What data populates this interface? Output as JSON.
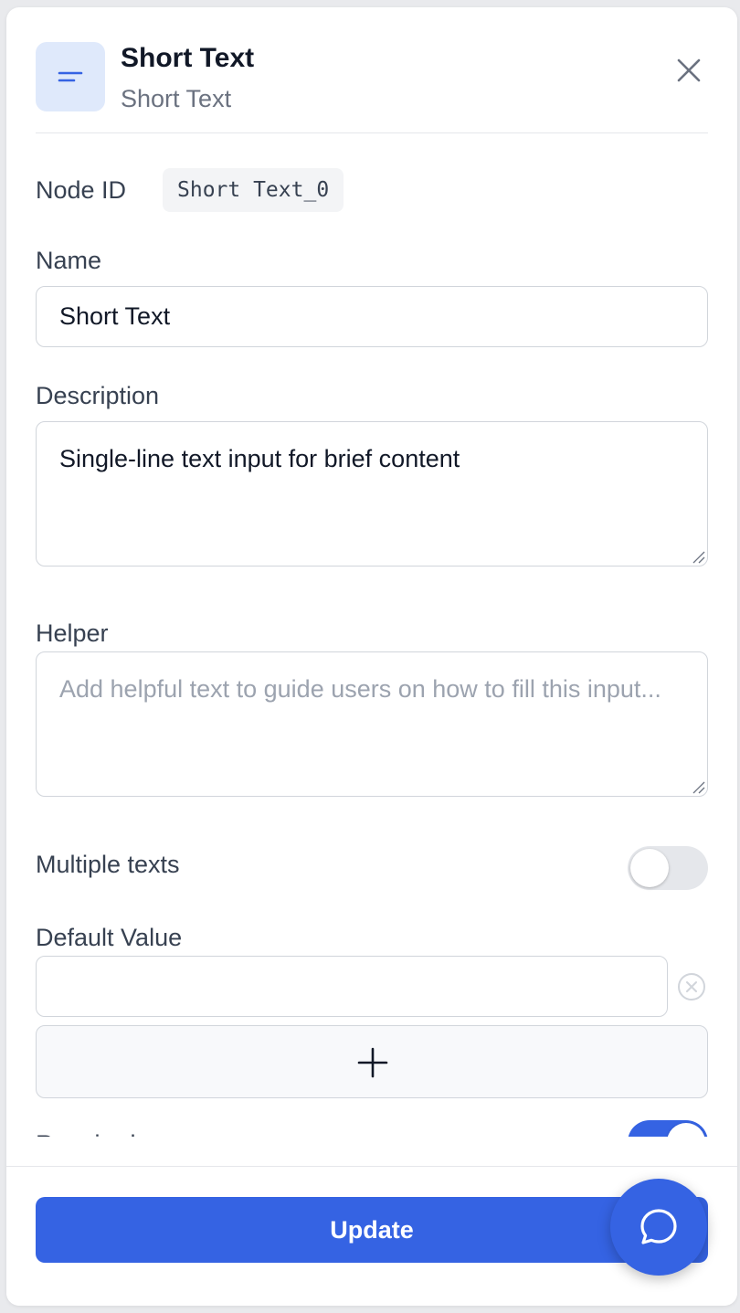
{
  "header": {
    "title": "Short Text",
    "subtitle": "Short Text",
    "icon": "short-text-icon",
    "close_icon": "close-icon"
  },
  "node": {
    "label": "Node ID",
    "id": "Short Text_0"
  },
  "fields": {
    "name": {
      "label": "Name",
      "value": "Short Text"
    },
    "description": {
      "label": "Description",
      "value": "Single-line text input for brief content"
    },
    "helper": {
      "label": "Helper",
      "value": "",
      "placeholder": "Add helpful text to guide users on how to fill this input..."
    },
    "multiple_texts": {
      "label": "Multiple texts",
      "enabled": false
    },
    "default_value": {
      "label": "Default Value",
      "value": ""
    },
    "required": {
      "label": "Required",
      "enabled": true
    }
  },
  "footer": {
    "update_label": "Update"
  },
  "colors": {
    "accent": "#3563e3",
    "icon_bg": "#dfe9fb"
  }
}
